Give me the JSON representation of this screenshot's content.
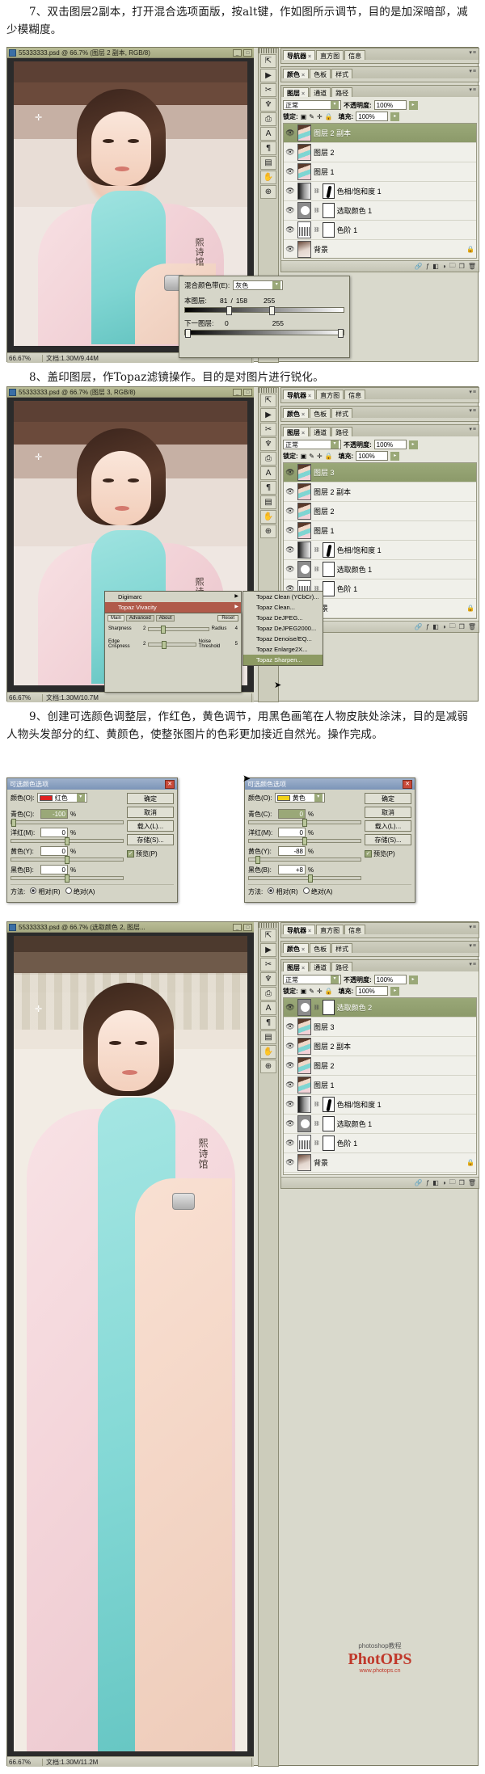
{
  "steps": {
    "s7": "7、双击图层2副本，打开混合选项面版，按alt键，作如图所示调节，目的是加深暗部，减少模糊度。",
    "s8": "8、盖印图层，作Topaz滤镜操作。目的是对图片进行锐化。",
    "s9": "9、创建可选颜色调整层，作红色，黄色调节，用黑色画笔在人物皮肤处涂沫，目的是减弱人物头发部分的红、黄颜色，使整张图片的色彩更加接近自然光。操作完成。"
  },
  "win1": {
    "title": "55333333.psd @ 66.7% (图层 2 副本, RGB/8)",
    "status_zoom": "66.67%",
    "status_size": "文档:1.30M/9.44M",
    "min": "_",
    "max": "□",
    "close": "×",
    "panels": {
      "nav_tabs": [
        "导航器",
        "直方图",
        "信息"
      ],
      "color_tabs": [
        "颜色",
        "色板",
        "样式"
      ],
      "layer_tabs": [
        "图层",
        "通道",
        "路径"
      ],
      "blend_mode": "正常",
      "opacity_label": "不透明度:",
      "opacity_value": "100%",
      "lock_label": "锁定:",
      "fill_label": "填充:",
      "fill_value": "100%"
    },
    "layers": [
      {
        "name": "图层 2 副本",
        "selected": true,
        "type": "pixel"
      },
      {
        "name": "图层 2",
        "selected": false,
        "type": "pixel"
      },
      {
        "name": "图层 1",
        "selected": false,
        "type": "pixel"
      },
      {
        "name": "色相/饱和度 1",
        "selected": false,
        "type": "adj-hue"
      },
      {
        "name": "选取颜色 1",
        "selected": false,
        "type": "adj-sel"
      },
      {
        "name": "色阶 1",
        "selected": false,
        "type": "adj-levels"
      },
      {
        "name": "背景",
        "selected": false,
        "type": "bg",
        "locked": true
      }
    ]
  },
  "blend_dialog": {
    "channel_label": "混合颜色带(E):",
    "channel_value": "灰色",
    "this_layer_label": "本图层:",
    "this_layer_values": [
      "81",
      "/",
      "158",
      "255"
    ],
    "next_layer_label": "下一图层:",
    "next_layer_values": [
      "0",
      "255"
    ]
  },
  "win2": {
    "title": "55333333.psd @ 66.7% (图层 3, RGB/8)",
    "status_zoom": "66.67%",
    "status_size": "文档:1.30M/10.7M",
    "panels": {
      "nav_tabs": [
        "导航器",
        "直方图",
        "信息"
      ],
      "color_tabs": [
        "颜色",
        "色板",
        "样式"
      ],
      "layer_tabs": [
        "图层",
        "通道",
        "路径"
      ],
      "blend_mode": "正常",
      "opacity_label": "不透明度:",
      "opacity_value": "100%",
      "lock_label": "锁定:",
      "fill_label": "填充:",
      "fill_value": "100%"
    },
    "layers": [
      {
        "name": "图层 3",
        "selected": true,
        "type": "pixel"
      },
      {
        "name": "图层 2 副本",
        "selected": false,
        "type": "pixel"
      },
      {
        "name": "图层 2",
        "selected": false,
        "type": "pixel"
      },
      {
        "name": "图层 1",
        "selected": false,
        "type": "pixel"
      },
      {
        "name": "色相/饱和度 1",
        "selected": false,
        "type": "adj-hue"
      },
      {
        "name": "选取颜色 1",
        "selected": false,
        "type": "adj-sel"
      },
      {
        "name": "色阶 1",
        "selected": false,
        "type": "adj-levels"
      },
      {
        "name": "背景",
        "selected": false,
        "type": "bg",
        "locked": true
      }
    ]
  },
  "topaz": {
    "root_items": [
      {
        "label": "Digimarc",
        "submenu": true,
        "state": "normal"
      },
      {
        "label": "Topaz Vivacity",
        "submenu": true,
        "state": "highlight"
      }
    ],
    "sub_items": [
      {
        "label": "Topaz Clean (YCbCr)...",
        "state": "normal"
      },
      {
        "label": "Topaz Clean...",
        "state": "normal"
      },
      {
        "label": "Topaz DeJPEG...",
        "state": "normal"
      },
      {
        "label": "Topaz DeJPEG2000...",
        "state": "normal"
      },
      {
        "label": "Topaz Denoise/EQ...",
        "state": "normal"
      },
      {
        "label": "Topaz Enlarge2X...",
        "state": "normal"
      },
      {
        "label": "Topaz Sharpen...",
        "state": "selected"
      }
    ],
    "panel": {
      "tabs": [
        "Main",
        "Advanced",
        "About"
      ],
      "reset_btn": "Reset",
      "rows": [
        {
          "label": "Sharpness",
          "value": "2",
          "label2": "Radius",
          "value2": "4"
        },
        {
          "label": "Edge Crispness",
          "value": "2",
          "label2": "Noise Threshold",
          "value2": "5"
        }
      ]
    }
  },
  "selcolor_red": {
    "title": "可选颜色选项",
    "color_label": "颜色(O):",
    "color_value": "红色",
    "rows": [
      {
        "label": "青色(C):",
        "value": "-100",
        "unit": "%"
      },
      {
        "label": "洋红(M):",
        "value": "0",
        "unit": "%"
      },
      {
        "label": "黄色(Y):",
        "value": "0",
        "unit": "%"
      },
      {
        "label": "黑色(B):",
        "value": "0",
        "unit": "%"
      }
    ],
    "method_label": "方法:",
    "method_rel": "相对(R)",
    "method_abs": "绝对(A)",
    "buttons": [
      "确定",
      "取消",
      "载入(L)...",
      "存储(S)..."
    ],
    "preview": "预览(P)"
  },
  "selcolor_yellow": {
    "title": "可选颜色选项",
    "color_label": "颜色(O):",
    "color_value": "黄色",
    "rows": [
      {
        "label": "青色(C):",
        "value": "0",
        "unit": "%"
      },
      {
        "label": "洋红(M):",
        "value": "0",
        "unit": "%"
      },
      {
        "label": "黄色(Y):",
        "value": "-88",
        "unit": "%"
      },
      {
        "label": "黑色(B):",
        "value": "+8",
        "unit": "%"
      }
    ],
    "method_label": "方法:",
    "method_rel": "相对(R)",
    "method_abs": "绝对(A)",
    "buttons": [
      "确定",
      "取消",
      "载入(L)...",
      "存储(S)..."
    ],
    "preview": "预览(P)"
  },
  "win3": {
    "title": "55333333.psd @ 66.7% (选取颜色 2, 图层...",
    "status_zoom": "66.67%",
    "status_size": "文档:1.30M/11.2M",
    "panels": {
      "nav_tabs": [
        "导航器",
        "直方图",
        "信息"
      ],
      "color_tabs": [
        "颜色",
        "色板",
        "样式"
      ],
      "layer_tabs": [
        "图层",
        "通道",
        "路径"
      ],
      "blend_mode": "正常",
      "opacity_label": "不透明度:",
      "opacity_value": "100%",
      "lock_label": "锁定:",
      "fill_label": "填充:",
      "fill_value": "100%"
    },
    "layers": [
      {
        "name": "选取颜色 2",
        "selected": true,
        "type": "adj-sel"
      },
      {
        "name": "图层 3",
        "selected": false,
        "type": "pixel"
      },
      {
        "name": "图层 2 副本",
        "selected": false,
        "type": "pixel"
      },
      {
        "name": "图层 2",
        "selected": false,
        "type": "pixel"
      },
      {
        "name": "图层 1",
        "selected": false,
        "type": "pixel"
      },
      {
        "name": "色相/饱和度 1",
        "selected": false,
        "type": "adj-hue"
      },
      {
        "name": "选取颜色 1",
        "selected": false,
        "type": "adj-sel"
      },
      {
        "name": "色阶 1",
        "selected": false,
        "type": "adj-levels"
      },
      {
        "name": "背景",
        "selected": false,
        "type": "bg",
        "locked": true
      }
    ]
  },
  "watermark": {
    "line1": "photoshop",
    "line2": "PhotOPS",
    "line3": "www.photops.cn",
    "cn": "photoshop教程"
  },
  "colors": {
    "accent": "#9aa878",
    "title_bar": "#adb087",
    "panel_bg": "#d4d4c6",
    "close_red": "#c94a3a"
  }
}
